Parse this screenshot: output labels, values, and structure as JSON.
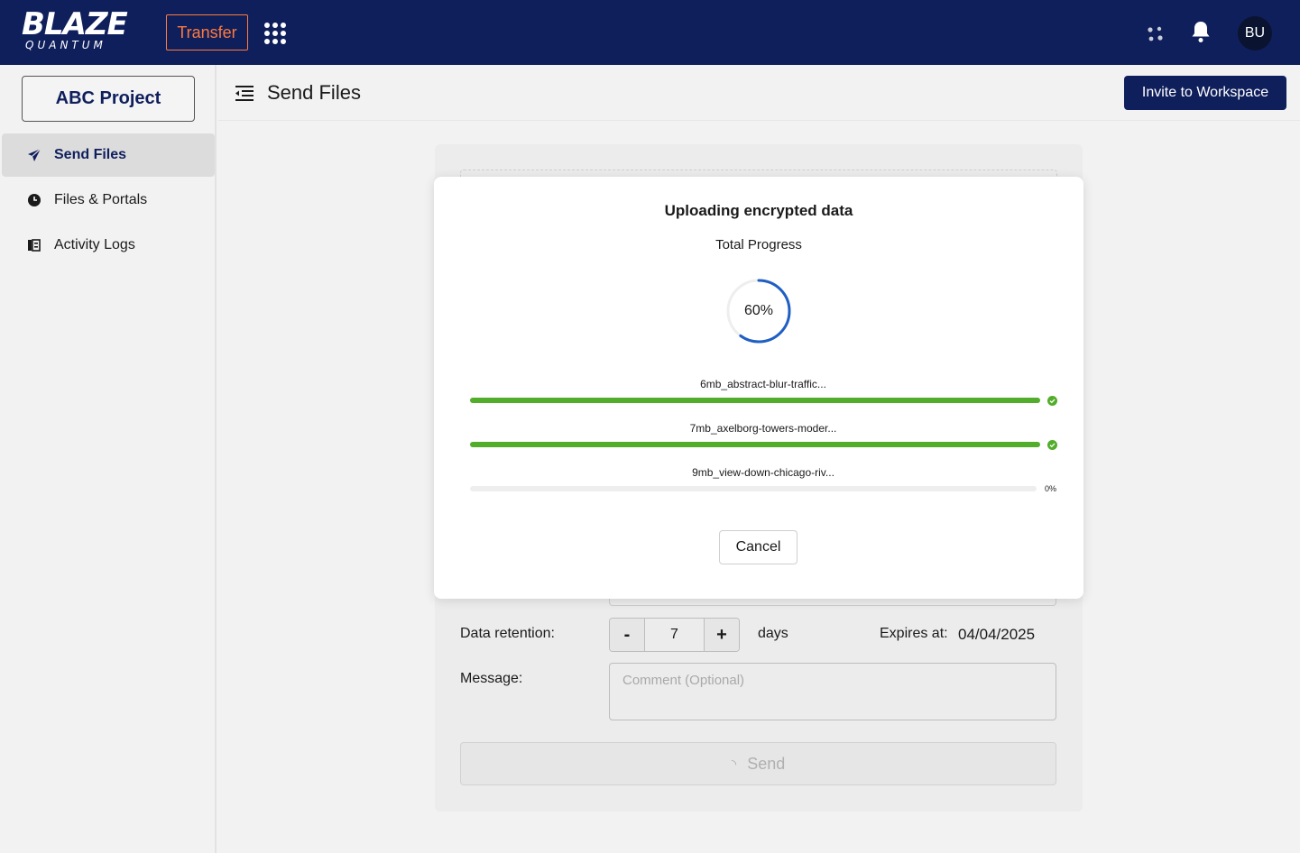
{
  "topbar": {
    "logo_main": "BLAZE",
    "logo_sub": "QUANTUM",
    "app_name": "Transfer",
    "avatar_initials": "BU",
    "icons": [
      "apps-grid-icon",
      "dots-icon",
      "bell-icon"
    ]
  },
  "sidebar": {
    "project": "ABC Project",
    "items": [
      {
        "label": "Send Files",
        "icon": "send-icon",
        "active": true
      },
      {
        "label": "Files & Portals",
        "icon": "clock-icon",
        "active": false
      },
      {
        "label": "Activity Logs",
        "icon": "log-icon",
        "active": false
      }
    ]
  },
  "header": {
    "title": "Send Files",
    "invite_label": "Invite to Workspace"
  },
  "form": {
    "retention_label": "Data retention:",
    "retention_value": "7",
    "minus_label": "-",
    "plus_label": "+",
    "days_label": "days",
    "expires_label": "Expires at:",
    "expires_value": "04/04/2025",
    "message_label": "Message:",
    "message_placeholder": "Comment (Optional)",
    "send_label": "Send"
  },
  "modal": {
    "title": "Uploading encrypted data",
    "subtitle": "Total Progress",
    "total_progress": 0.6,
    "total_progress_label": "60%",
    "cancel_label": "Cancel",
    "files": [
      {
        "name": "6mb_abstract-blur-traffic...",
        "progress": 1.0,
        "status": "done"
      },
      {
        "name": "7mb_axelborg-towers-moder...",
        "progress": 1.0,
        "status": "done"
      },
      {
        "name": "9mb_view-down-chicago-riv...",
        "progress": 0.0,
        "status": "pending",
        "percent_label": "0%"
      }
    ]
  },
  "colors": {
    "navy": "#0f1f5c",
    "accent_orange": "#ff7a3c",
    "progress_green": "#52ad2b",
    "ring_blue": "#1f5fc4"
  }
}
